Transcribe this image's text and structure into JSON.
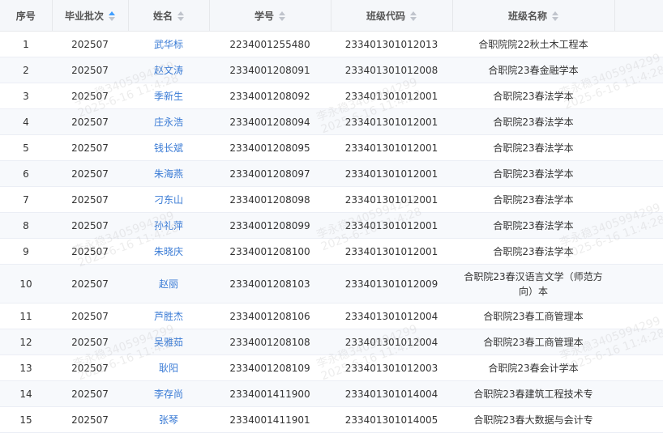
{
  "table": {
    "headers": [
      "序号",
      "毕业批次",
      "姓名",
      "学号",
      "班级代码",
      "班级名称"
    ],
    "sort_active": "毕业批次",
    "rows": [
      {
        "no": "1",
        "batch": "202507",
        "name": "武华标",
        "sid": "2234001255480",
        "code": "233401301012013",
        "cls": "合职院院22秋土木工程本"
      },
      {
        "no": "2",
        "batch": "202507",
        "name": "赵文涛",
        "sid": "2334001208091",
        "code": "233401301012008",
        "cls": "合职院23春金融学本"
      },
      {
        "no": "3",
        "batch": "202507",
        "name": "季新生",
        "sid": "2334001208092",
        "code": "233401301012001",
        "cls": "合职院23春法学本"
      },
      {
        "no": "4",
        "batch": "202507",
        "name": "庄永浩",
        "sid": "2334001208094",
        "code": "233401301012001",
        "cls": "合职院23春法学本"
      },
      {
        "no": "5",
        "batch": "202507",
        "name": "钱长斌",
        "sid": "2334001208095",
        "code": "233401301012001",
        "cls": "合职院23春法学本"
      },
      {
        "no": "6",
        "batch": "202507",
        "name": "朱海燕",
        "sid": "2334001208097",
        "code": "233401301012001",
        "cls": "合职院23春法学本"
      },
      {
        "no": "7",
        "batch": "202507",
        "name": "刁东山",
        "sid": "2334001208098",
        "code": "233401301012001",
        "cls": "合职院23春法学本"
      },
      {
        "no": "8",
        "batch": "202507",
        "name": "孙礼萍",
        "sid": "2334001208099",
        "code": "233401301012001",
        "cls": "合职院23春法学本"
      },
      {
        "no": "9",
        "batch": "202507",
        "name": "朱晓庆",
        "sid": "2334001208100",
        "code": "233401301012001",
        "cls": "合职院23春法学本"
      },
      {
        "no": "10",
        "batch": "202507",
        "name": "赵丽",
        "sid": "2334001208103",
        "code": "233401301012009",
        "cls": "合职院23春汉语言文学（师范方向）本"
      },
      {
        "no": "11",
        "batch": "202507",
        "name": "芦胜杰",
        "sid": "2334001208106",
        "code": "233401301012004",
        "cls": "合职院23春工商管理本"
      },
      {
        "no": "12",
        "batch": "202507",
        "name": "吴雅茹",
        "sid": "2334001208108",
        "code": "233401301012004",
        "cls": "合职院23春工商管理本"
      },
      {
        "no": "13",
        "batch": "202507",
        "name": "耿阳",
        "sid": "2334001208109",
        "code": "233401301012003",
        "cls": "合职院23春会计学本"
      },
      {
        "no": "14",
        "batch": "202507",
        "name": "李存尚",
        "sid": "2334001411900",
        "code": "233401301014004",
        "cls": "合职院23春建筑工程技术专"
      },
      {
        "no": "15",
        "batch": "202507",
        "name": "张琴",
        "sid": "2334001411901",
        "code": "233401301014005",
        "cls": "合职院23春大数据与会计专"
      }
    ]
  },
  "watermark": {
    "line1": "李永稳3405994299",
    "line2": "2025-6-16 11:4:28"
  },
  "colors": {
    "header_bg": "#f5f7fa",
    "link": "#3a7bd5",
    "sort_active": "#409eff",
    "stripe": "#f7f9fc"
  }
}
